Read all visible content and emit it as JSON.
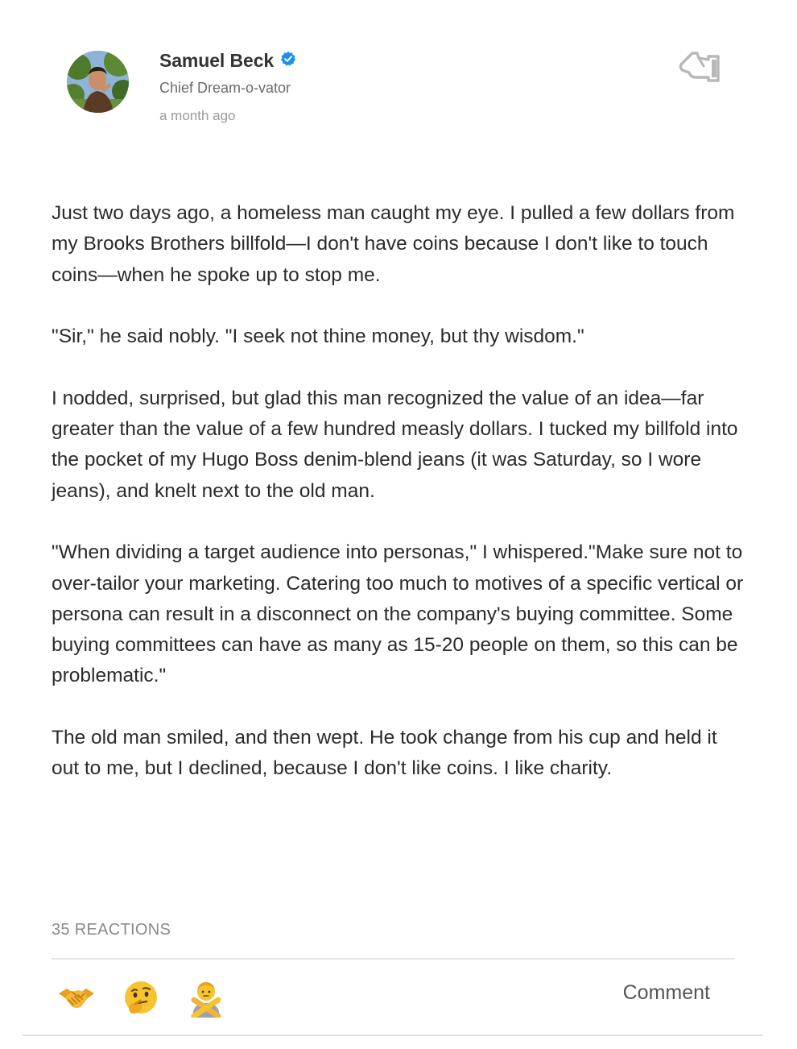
{
  "author": {
    "name": "Samuel Beck",
    "title": "Chief Dream-o-vator",
    "posted": "a month ago",
    "verified": true,
    "avatar_icon": "avatar-photo"
  },
  "post": {
    "paragraphs": [
      "Just two days ago, a homeless man caught my eye. I pulled a few dollars from my Brooks Brothers billfold—I don't have coins because I don't like to touch coins—when he spoke up to stop me.",
      "\"Sir,\" he said nobly. \"I seek not thine money, but thy wisdom.\"",
      "I nodded, surprised, but glad this man recognized the value of an idea—far greater than the value of a few hundred measly dollars. I tucked my billfold into the pocket of my Hugo Boss denim-blend jeans (it was Saturday, so I wore jeans), and knelt next to the old man.",
      "\"When dividing a target audience into personas,\" I whispered.\"Make sure not to over-tailor your marketing. Catering too much to motives of a specific vertical or persona can result in a disconnect on the company's buying committee. Some buying committees can have as many as 15-20 people on them, so this can be problematic.\"",
      "The old man smiled, and then wept. He took change from his cup and held it out to me, but I declined, because I don't like coins. I like charity."
    ]
  },
  "reactions": {
    "count_label": "35 REACTIONS",
    "items": [
      {
        "name": "handshake",
        "icon": "handshake-icon"
      },
      {
        "name": "thinking",
        "icon": "thinking-face-icon"
      },
      {
        "name": "no-gesture",
        "icon": "person-gesturing-no-icon"
      }
    ],
    "comment_label": "Comment"
  },
  "colors": {
    "verified": "#1d8fe8",
    "text": "#2b2b2b",
    "muted": "#8a8a8a"
  }
}
